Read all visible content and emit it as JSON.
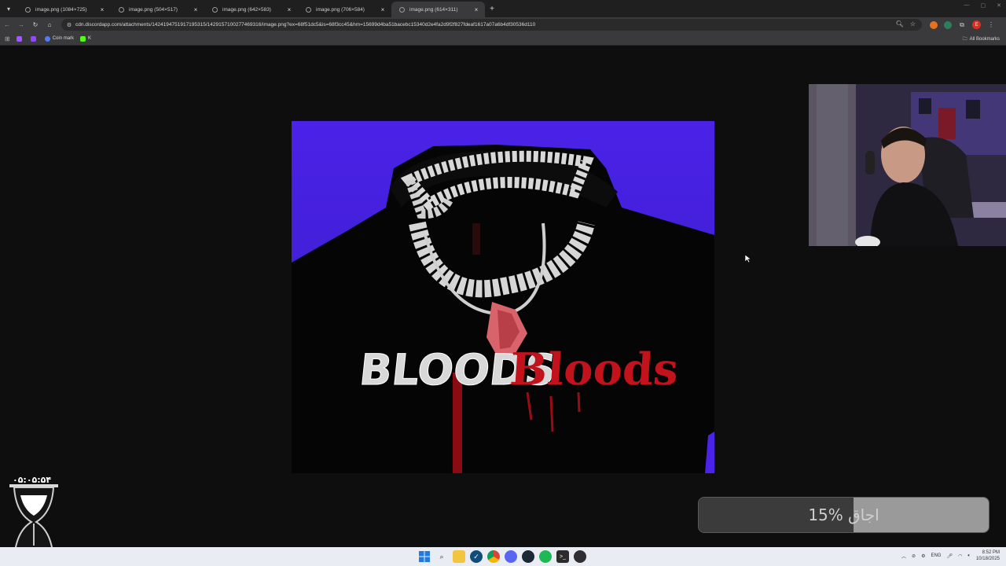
{
  "browser": {
    "tabs": [
      {
        "title": "image.png (1084×725)",
        "active": false
      },
      {
        "title": "image.png (504×517)",
        "active": false
      },
      {
        "title": "image.png (642×583)",
        "active": false
      },
      {
        "title": "image.png (706×584)",
        "active": false
      },
      {
        "title": "image.png (614×311)",
        "active": true
      }
    ],
    "new_tab": "+",
    "close_glyph": "×",
    "url": "cdn.discordapp.com/attachments/1424194751917195315/1429157100277469316/image.png?ex=68f51dc5&is=68f3cc45&hm=15699d4ba51bacebc15340d2e4fa2d9f2f827fdeaf1617a07a6b4df30536d110",
    "bookmarks": [
      {
        "label": "",
        "color": "#a259ff"
      },
      {
        "label": "",
        "color": "#9147ff"
      },
      {
        "label": "Coin mark",
        "color": "#4f7cff"
      },
      {
        "label": "K",
        "color": "#53fc18"
      }
    ],
    "all_bookmarks": "All Bookmarks",
    "profile_initial": "E"
  },
  "content": {
    "image_text_white": "BLOODS",
    "image_text_red": "Bloods",
    "accent_colors": {
      "background": "#4a22e8",
      "red_text": "#c2121c"
    }
  },
  "overlay": {
    "timer": "۰۵:۰۵:۵۴",
    "progress_label": "15% اجاق",
    "progress_fraction": 0.15
  },
  "taskbar": {
    "language": "ENG",
    "time": "8:52 PM",
    "date": "10/18/2025"
  }
}
